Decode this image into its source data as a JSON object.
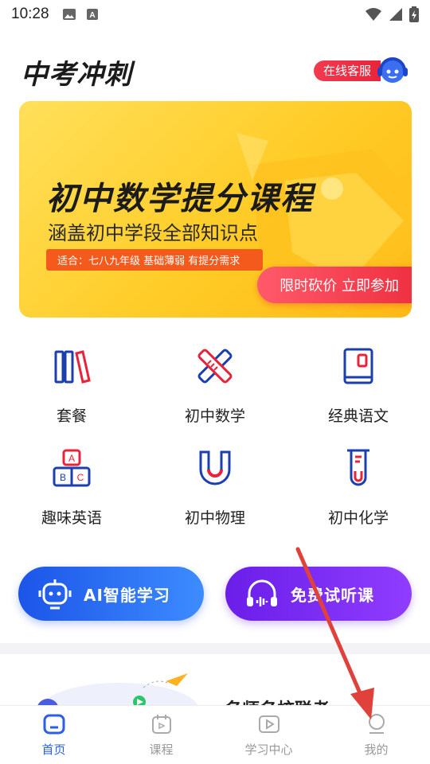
{
  "status_bar": {
    "time": "10:28"
  },
  "header": {
    "app_title": "中考冲刺",
    "service_label": "在线客服"
  },
  "banner": {
    "title": "初中数学提分课程",
    "subtitle": "涵盖初中学段全部知识点",
    "tag": "适合：七八九年级  基础薄弱  有提分需求",
    "cta": "限时砍价  立即参加"
  },
  "categories": [
    {
      "label": "套餐",
      "icon": "books-icon"
    },
    {
      "label": "初中数学",
      "icon": "ruler-pencil-icon"
    },
    {
      "label": "经典语文",
      "icon": "book-icon"
    },
    {
      "label": "趣味英语",
      "icon": "abc-blocks-icon"
    },
    {
      "label": "初中物理",
      "icon": "magnet-icon"
    },
    {
      "label": "初中化学",
      "icon": "test-tube-icon"
    }
  ],
  "actions": {
    "ai_label": "AI智能学习",
    "trial_label": "免费试听课"
  },
  "card_peek": {
    "heading": "名师名校联考"
  },
  "bottom_nav": [
    {
      "label": "首页",
      "icon": "home-icon",
      "active": true
    },
    {
      "label": "课程",
      "icon": "calendar-icon",
      "active": false
    },
    {
      "label": "学习中心",
      "icon": "play-video-icon",
      "active": false
    },
    {
      "label": "我的",
      "icon": "profile-icon",
      "active": false
    }
  ],
  "colors": {
    "primary_blue": "#2b5fe6",
    "accent_red": "#e8243a",
    "banner_yellow": "#ffcc27",
    "purple": "#7a2cf0"
  }
}
